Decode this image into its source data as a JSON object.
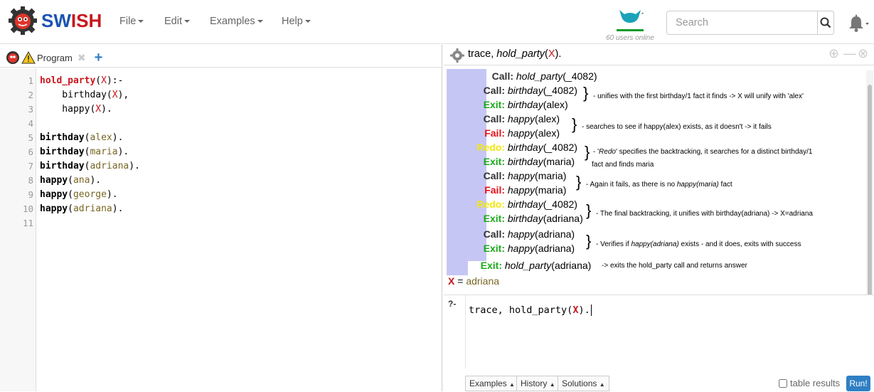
{
  "app": {
    "logo_part1": "SW",
    "logo_part2": "ISH"
  },
  "menu": [
    {
      "label": "File"
    },
    {
      "label": "Edit"
    },
    {
      "label": "Examples"
    },
    {
      "label": "Help"
    }
  ],
  "users_online": "60 users online",
  "search": {
    "placeholder": "Search"
  },
  "editor": {
    "tab_label": "Program",
    "lines": [
      "1",
      "2",
      "3",
      "4",
      "5",
      "6",
      "7",
      "8",
      "9",
      "10",
      "11"
    ]
  },
  "trace_header": {
    "prefix": "trace, ",
    "call": "hold_party",
    "open": "(",
    "var": "X",
    "close": ")."
  },
  "trace_rows": [
    {
      "port": "Call:",
      "goal": "hold_party",
      "args": "(_4082)"
    },
    {
      "port": "Call:",
      "goal": "birthday",
      "args": "(_4082)"
    },
    {
      "port": "Exit:",
      "goal": "birthday",
      "args": "(alex)"
    },
    {
      "port": "Call:",
      "goal": "happy",
      "args": "(alex)"
    },
    {
      "port": "Fail:",
      "goal": "happy",
      "args": "(alex)"
    },
    {
      "port": "Redo:",
      "goal": "birthday",
      "args": "(_4082)"
    },
    {
      "port": "Exit:",
      "goal": "birthday",
      "args": "(maria)"
    },
    {
      "port": "Call:",
      "goal": "happy",
      "args": "(maria)"
    },
    {
      "port": "Fail:",
      "goal": "happy",
      "args": "(maria)"
    },
    {
      "port": "Redo:",
      "goal": "birthday",
      "args": "(_4082)"
    },
    {
      "port": "Exit:",
      "goal": "birthday",
      "args": "(adriana)"
    },
    {
      "port": "Call:",
      "goal": "happy",
      "args": "(adriana)"
    },
    {
      "port": "Exit:",
      "goal": "happy",
      "args": "(adriana)"
    },
    {
      "port": "Exit:",
      "goal": "hold_party",
      "args": "(adriana)"
    }
  ],
  "notes": {
    "n1": "- unifies with the first birthday/1 fact it finds -> X will unify with 'alex'",
    "n2": "- searches to see if happy(alex) exists, as it doesn't -> it fails",
    "n3a": "- '",
    "n3b": "Redo",
    "n3c": "' specifies the backtracking, it searches for a distinct birthday/1",
    "n3d": "fact and finds maria",
    "n4a": "- Again it fails, as there is no ",
    "n4b": "happy(maria)",
    "n4c": "  fact",
    "n5": "- The final backtracking, it unifies with birthday(adriana) -> X=adriana",
    "n6a": "- Verifies if ",
    "n6b": "happy(adriana)",
    "n6c": " exists - and it does, exits with success",
    "n7": "-> exits the hold_party call and returns answer"
  },
  "answer": {
    "var": "X",
    "eq": " = ",
    "value": "adriana"
  },
  "query": {
    "prompt": "?-",
    "prefix": "trace, hold_party(",
    "var": "X",
    "suffix": ")."
  },
  "bottom_buttons": {
    "examples": "Examples",
    "history": "History",
    "solutions": "Solutions"
  },
  "table_results_label": "table results",
  "run_label": "Run!"
}
